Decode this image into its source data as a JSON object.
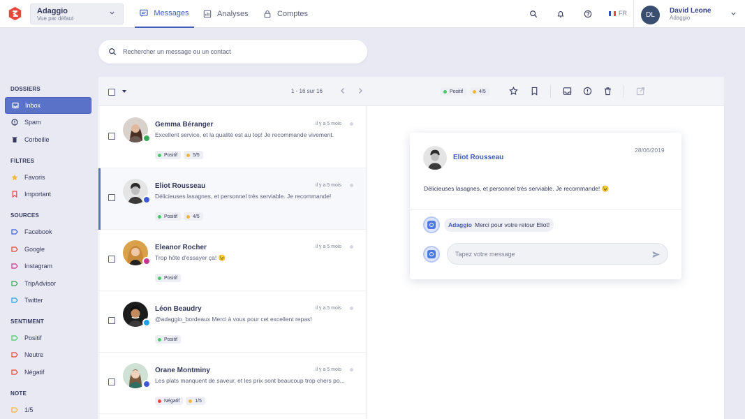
{
  "colors": {
    "accent": "#3e5bb7",
    "sidebar_active_bg": "#5a73c8",
    "positive": "#4cc96a",
    "negative": "#e8453c",
    "rating": "#f5b73b",
    "page_bg": "#e8e9f3"
  },
  "account": {
    "name": "Adaggio",
    "view": "Vue par défaut"
  },
  "nav": {
    "tabs": [
      {
        "label": "Messages",
        "icon": "chat-icon"
      },
      {
        "label": "Analyses",
        "icon": "chart-icon"
      },
      {
        "label": "Comptes",
        "icon": "lock-icon"
      }
    ]
  },
  "topbar": {
    "lang": "FR",
    "user": {
      "initials": "DL",
      "name": "David Leone",
      "org": "Adaggio"
    }
  },
  "search": {
    "placeholder": "Rechercher un message ou un contact",
    "value": ""
  },
  "sidebar": {
    "dossiers": {
      "title": "DOSSIERS",
      "items": [
        {
          "label": "Inbox",
          "icon": "inbox-icon",
          "active": true
        },
        {
          "label": "Spam",
          "icon": "alert-icon"
        },
        {
          "label": "Corbeille",
          "icon": "trash-icon"
        }
      ]
    },
    "filtres": {
      "title": "FILTRES",
      "items": [
        {
          "label": "Favoris",
          "icon": "star-icon"
        },
        {
          "label": "Important",
          "icon": "bookmark-icon"
        }
      ]
    },
    "sources": {
      "title": "SOURCES",
      "items": [
        {
          "label": "Facebook",
          "color": "#3b5bdb"
        },
        {
          "label": "Google",
          "color": "#e8453c"
        },
        {
          "label": "Instagram",
          "color": "#c2368f"
        },
        {
          "label": "TripAdvisor",
          "color": "#34a853"
        },
        {
          "label": "Twitter",
          "color": "#1da1f2"
        }
      ]
    },
    "sentiment": {
      "title": "SENTIMENT",
      "items": [
        {
          "label": "Positif",
          "color": "#4cc96a"
        },
        {
          "label": "Neutre",
          "color": "#e8453c"
        },
        {
          "label": "Négatif",
          "color": "#e8453c"
        }
      ]
    },
    "note": {
      "title": "NOTE",
      "items": [
        {
          "label": "1/5",
          "color": "#f5b73b"
        }
      ]
    }
  },
  "toolbar": {
    "page_info": "1 - 16 sur 16",
    "chips": [
      {
        "label": "Positif",
        "color": "#4cc96a"
      },
      {
        "label": "4/5",
        "color": "#f5b73b"
      }
    ]
  },
  "messages": [
    {
      "name": "Gemma Béranger",
      "time": "il y a 5 mois",
      "text": "Excellent service, et la qualité est au top! Je recommande vivement.",
      "source": "tripadvisor",
      "tags": [
        {
          "label": "Positif",
          "color": "#4cc96a"
        },
        {
          "label": "5/5",
          "color": "#f5b73b"
        }
      ]
    },
    {
      "name": "Eliot Rousseau",
      "time": "il y a 5 mois",
      "text": "Délicieuses lasagnes, et personnel très serviable. Je recommande!",
      "source": "facebook",
      "selected": true,
      "tags": [
        {
          "label": "Positif",
          "color": "#4cc96a"
        },
        {
          "label": "4/5",
          "color": "#f5b73b"
        }
      ]
    },
    {
      "name": "Eleanor Rocher",
      "time": "il y a 5 mois",
      "text": "Trop hôte d'essayer ça! 😉",
      "source": "instagram",
      "tags": [
        {
          "label": "Positif",
          "color": "#4cc96a"
        }
      ]
    },
    {
      "name": "Léon Beaudry",
      "time": "il y a 5 mois",
      "text": "@adaggio_bordeaux Merci à vous pour cet excellent repas!",
      "source": "twitter",
      "tags": [
        {
          "label": "Positif",
          "color": "#4cc96a"
        }
      ]
    },
    {
      "name": "Orane Montminy",
      "time": "il y a 5 mois",
      "text": "Les plats manquent de saveur, et les prix sont beaucoup trop chers po...",
      "source": "facebook",
      "tags": [
        {
          "label": "Négatif",
          "color": "#e8453c"
        },
        {
          "label": "1/5",
          "color": "#f5b73b"
        }
      ]
    }
  ],
  "detail": {
    "name": "Eliot Rousseau",
    "date": "28/06/2019",
    "text": "Délicieuses lasagnes, et personnel très serviable. Je recommande! 😉",
    "reply": {
      "author": "Adaggio",
      "text": "Merci pour votre retour Eliot!"
    },
    "compose_placeholder": "Tapez votre message"
  }
}
